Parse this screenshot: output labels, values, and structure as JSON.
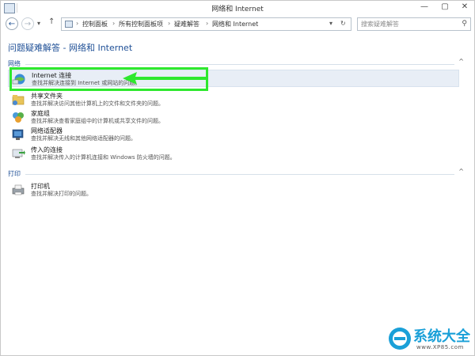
{
  "window": {
    "title": "网络和 Internet",
    "minimize": "—",
    "maximize": "▢",
    "close": "✕"
  },
  "nav": {
    "back_icon": "←",
    "forward_icon": "→",
    "dropdown_icon": "▾",
    "up_icon": "↑",
    "breadcrumbs": [
      "控制面板",
      "所有控制面板项",
      "疑难解答",
      "网络和 Internet"
    ],
    "crumb_sep": "›",
    "refresh_icon": "↻",
    "search_placeholder": "搜索疑难解答",
    "search_icon": "⚲"
  },
  "page": {
    "title": "问题疑难解答 - 网络和 Internet"
  },
  "sections": [
    {
      "label": "网络",
      "items": [
        {
          "title": "Internet 连接",
          "desc": "查找并解决连接到 Internet 或网站的问题。",
          "icon": "globe-network-icon",
          "highlighted": true
        },
        {
          "title": "共享文件夹",
          "desc": "查找并解决访问其他计算机上的文件和文件夹的问题。",
          "icon": "shared-folder-icon",
          "highlighted": false
        },
        {
          "title": "家庭组",
          "desc": "查找并解决查看家庭组中的计算机或共享文件的问题。",
          "icon": "homegroup-icon",
          "highlighted": false
        },
        {
          "title": "网络适配器",
          "desc": "查找并解决无线和其他网络适配器的问题。",
          "icon": "network-adapter-icon",
          "highlighted": false
        },
        {
          "title": "传入的连接",
          "desc": "查找并解决传入的计算机连接和 Windows 防火墙的问题。",
          "icon": "incoming-connection-icon",
          "highlighted": false
        }
      ]
    },
    {
      "label": "打印",
      "items": [
        {
          "title": "打印机",
          "desc": "查找并解决打印的问题。",
          "icon": "printer-icon",
          "highlighted": false
        }
      ]
    }
  ],
  "collapse_icon": "^",
  "watermark": {
    "text": "系统大全",
    "sub": "www.XP85.com"
  },
  "colors": {
    "accent": "#1e4f96",
    "annotation": "#2ee82e",
    "highlight": "#e8eef6"
  }
}
